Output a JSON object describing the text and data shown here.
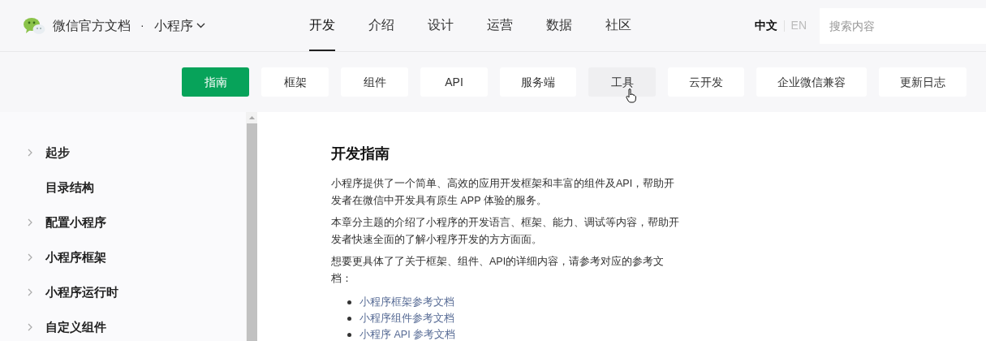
{
  "header": {
    "site_title": "微信官方文档",
    "separator": "·",
    "product": "小程序"
  },
  "nav": [
    {
      "label": "开发",
      "selected": true
    },
    {
      "label": "介绍",
      "selected": false
    },
    {
      "label": "设计",
      "selected": false
    },
    {
      "label": "运营",
      "selected": false
    },
    {
      "label": "数据",
      "selected": false
    },
    {
      "label": "社区",
      "selected": false
    }
  ],
  "languages": [
    {
      "label": "中文",
      "selected": true
    },
    {
      "label": "EN",
      "selected": false
    }
  ],
  "search": {
    "placeholder": "搜索内容"
  },
  "subnav": [
    {
      "label": "指南",
      "selected": true,
      "hovered": false
    },
    {
      "label": "框架",
      "selected": false,
      "hovered": false
    },
    {
      "label": "组件",
      "selected": false,
      "hovered": false
    },
    {
      "label": "API",
      "selected": false,
      "hovered": false
    },
    {
      "label": "服务端",
      "selected": false,
      "hovered": false
    },
    {
      "label": "工具",
      "selected": false,
      "hovered": true
    },
    {
      "label": "云开发",
      "selected": false,
      "hovered": false
    },
    {
      "label": "企业微信兼容",
      "selected": false,
      "hovered": false
    },
    {
      "label": "更新日志",
      "selected": false,
      "hovered": false
    }
  ],
  "sidebar": {
    "items": [
      {
        "label": "起步",
        "expandable": true
      },
      {
        "label": "目录结构",
        "expandable": false
      },
      {
        "label": "配置小程序",
        "expandable": true
      },
      {
        "label": "小程序框架",
        "expandable": true
      },
      {
        "label": "小程序运行时",
        "expandable": true
      },
      {
        "label": "自定义组件",
        "expandable": true
      }
    ]
  },
  "article": {
    "title": "开发指南",
    "paragraphs": [
      "小程序提供了一个简单、高效的应用开发框架和丰富的组件及API，帮助开发者在微信中开发具有原生 APP 体验的服务。",
      "本章分主题的介绍了小程序的开发语言、框架、能力、调试等内容，帮助开发者快速全面的了解小程序开发的方方面面。",
      "想要更具体了了关于框架、组件、API的详细内容，请参考对应的参考文档："
    ],
    "links": [
      "小程序框架参考文档",
      "小程序组件参考文档",
      "小程序 API 参考文档"
    ]
  }
}
